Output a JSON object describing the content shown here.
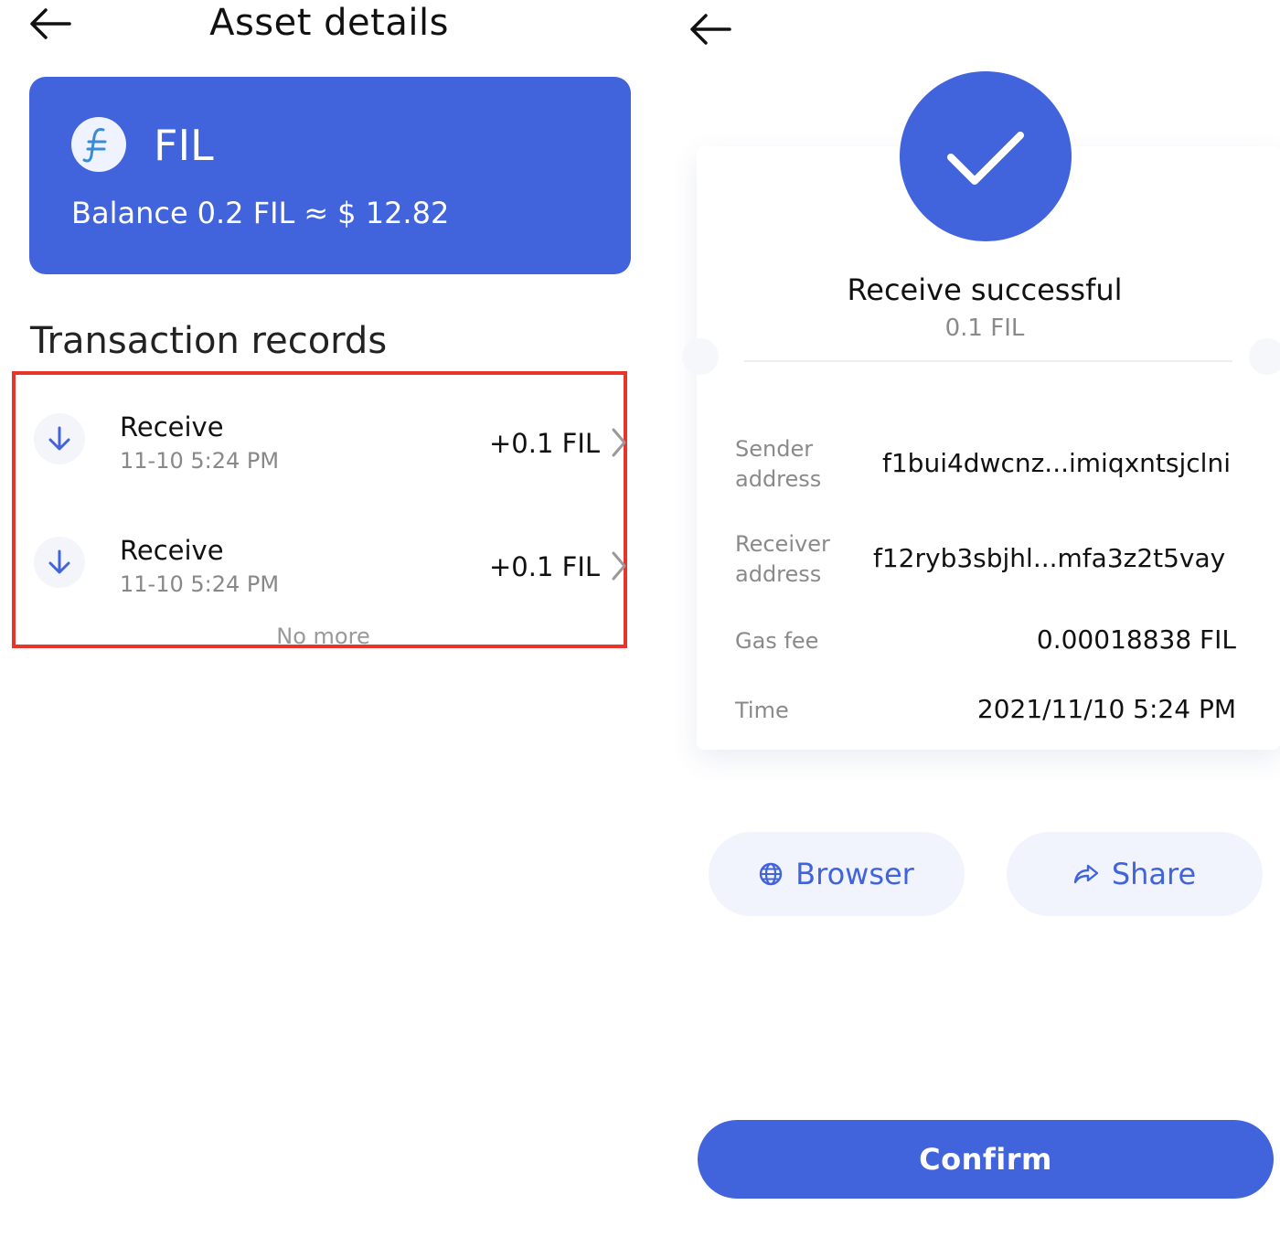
{
  "left_screen": {
    "title": "Asset details",
    "asset_card": {
      "coin_name": "FIL",
      "balance_label": "Balance",
      "balance_value": "0.2 FIL",
      "approx_symbol": "≈",
      "fiat_value": "$ 12.82"
    },
    "section_title": "Transaction records",
    "transactions": [
      {
        "type": "Receive",
        "time": "11-10 5:24 PM",
        "amount": "+0.1 FIL"
      },
      {
        "type": "Receive",
        "time": "11-10 5:24 PM",
        "amount": "+0.1 FIL"
      }
    ],
    "no_more": "No more"
  },
  "right_screen": {
    "status_title": "Receive successful",
    "status_amount": "0.1 FIL",
    "details": {
      "sender_label_1": "Sender",
      "sender_label_2": "address",
      "sender_value": "f1bui4dwcnz...imiqxntsjclni",
      "receiver_label_1": "Receiver",
      "receiver_label_2": "address",
      "receiver_value": "f12ryb3sbjhl...mfa3z2t5vay",
      "gas_label": "Gas fee",
      "gas_value": "0.00018838 FIL",
      "time_label": "Time",
      "time_value": "2021/11/10 5:24 PM"
    },
    "browser_label": "Browser",
    "share_label": "Share",
    "confirm_label": "Confirm"
  },
  "colors": {
    "accent": "#4163dc",
    "highlight_border": "#e8352b",
    "muted_text": "#8a8a8a",
    "pill_bg": "#f2f4fd"
  },
  "icons": [
    "back-arrow-icon",
    "filecoin-logo-icon",
    "arrow-down-icon",
    "chevron-right-icon",
    "checkmark-icon",
    "globe-icon",
    "share-icon"
  ]
}
